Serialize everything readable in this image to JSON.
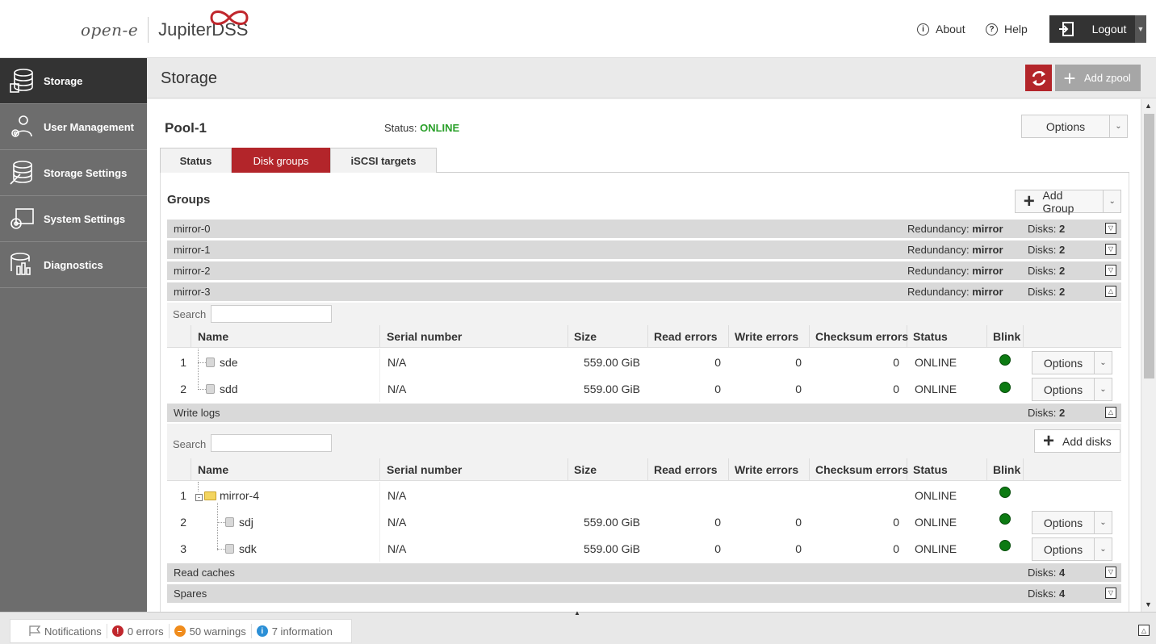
{
  "header": {
    "logo_brand": "open-e",
    "logo_product": "JupiterDSS",
    "about_label": "About",
    "help_label": "Help",
    "logout_label": "Logout"
  },
  "sidebar": {
    "items": [
      {
        "label": "Storage",
        "icon": "storage-icon",
        "active": true
      },
      {
        "label": "User Management",
        "icon": "user-management-icon",
        "active": false
      },
      {
        "label": "Storage Settings",
        "icon": "storage-settings-icon",
        "active": false
      },
      {
        "label": "System Settings",
        "icon": "system-settings-icon",
        "active": false
      },
      {
        "label": "Diagnostics",
        "icon": "diagnostics-icon",
        "active": false
      }
    ]
  },
  "page": {
    "title": "Storage",
    "add_zpool_label": "Add zpool"
  },
  "pool": {
    "name": "Pool-1",
    "status_label": "Status:",
    "status_value": "ONLINE",
    "options_label": "Options",
    "tabs": [
      {
        "label": "Status",
        "active": false
      },
      {
        "label": "Disk groups",
        "active": true
      },
      {
        "label": "iSCSI targets",
        "active": false
      }
    ]
  },
  "groups": {
    "title": "Groups",
    "add_group_label": "Add Group",
    "redundancy_label": "Redundancy:",
    "disks_label": "Disks:",
    "search_label": "Search",
    "columns": [
      "Name",
      "Serial number",
      "Size",
      "Read errors",
      "Write errors",
      "Checksum errors",
      "Status",
      "Blink"
    ],
    "rows": [
      {
        "name": "mirror-0",
        "redundancy": "mirror",
        "disks": "2",
        "expanded": false
      },
      {
        "name": "mirror-1",
        "redundancy": "mirror",
        "disks": "2",
        "expanded": false
      },
      {
        "name": "mirror-2",
        "redundancy": "mirror",
        "disks": "2",
        "expanded": false
      },
      {
        "name": "mirror-3",
        "redundancy": "mirror",
        "disks": "2",
        "expanded": true
      }
    ],
    "mirror3_disks": [
      {
        "index": "1",
        "name": "sde",
        "serial": "N/A",
        "size": "559.00 GiB",
        "read": "0",
        "write": "0",
        "checksum": "0",
        "status": "ONLINE",
        "options": "Options"
      },
      {
        "index": "2",
        "name": "sdd",
        "serial": "N/A",
        "size": "559.00 GiB",
        "read": "0",
        "write": "0",
        "checksum": "0",
        "status": "ONLINE",
        "options": "Options"
      }
    ]
  },
  "write_logs": {
    "name": "Write logs",
    "disks": "2",
    "add_disks_label": "Add disks",
    "rows": [
      {
        "index": "1",
        "name": "mirror-4",
        "serial": "N/A",
        "size": "",
        "read": "",
        "write": "",
        "checksum": "",
        "status": "ONLINE",
        "options": ""
      },
      {
        "index": "2",
        "name": "sdj",
        "serial": "N/A",
        "size": "559.00 GiB",
        "read": "0",
        "write": "0",
        "checksum": "0",
        "status": "ONLINE",
        "options": "Options"
      },
      {
        "index": "3",
        "name": "sdk",
        "serial": "N/A",
        "size": "559.00 GiB",
        "read": "0",
        "write": "0",
        "checksum": "0",
        "status": "ONLINE",
        "options": "Options"
      }
    ]
  },
  "read_caches": {
    "name": "Read caches",
    "disks": "4"
  },
  "spares": {
    "name": "Spares",
    "disks": "4"
  },
  "notifications": {
    "label": "Notifications",
    "errors": "0 errors",
    "warnings": "50 warnings",
    "information": "7 information"
  },
  "colors": {
    "accent_red": "#b3252a",
    "online_green": "#2aa02a",
    "sidebar_bg": "#6d6d6d",
    "sidebar_active": "#333333"
  }
}
